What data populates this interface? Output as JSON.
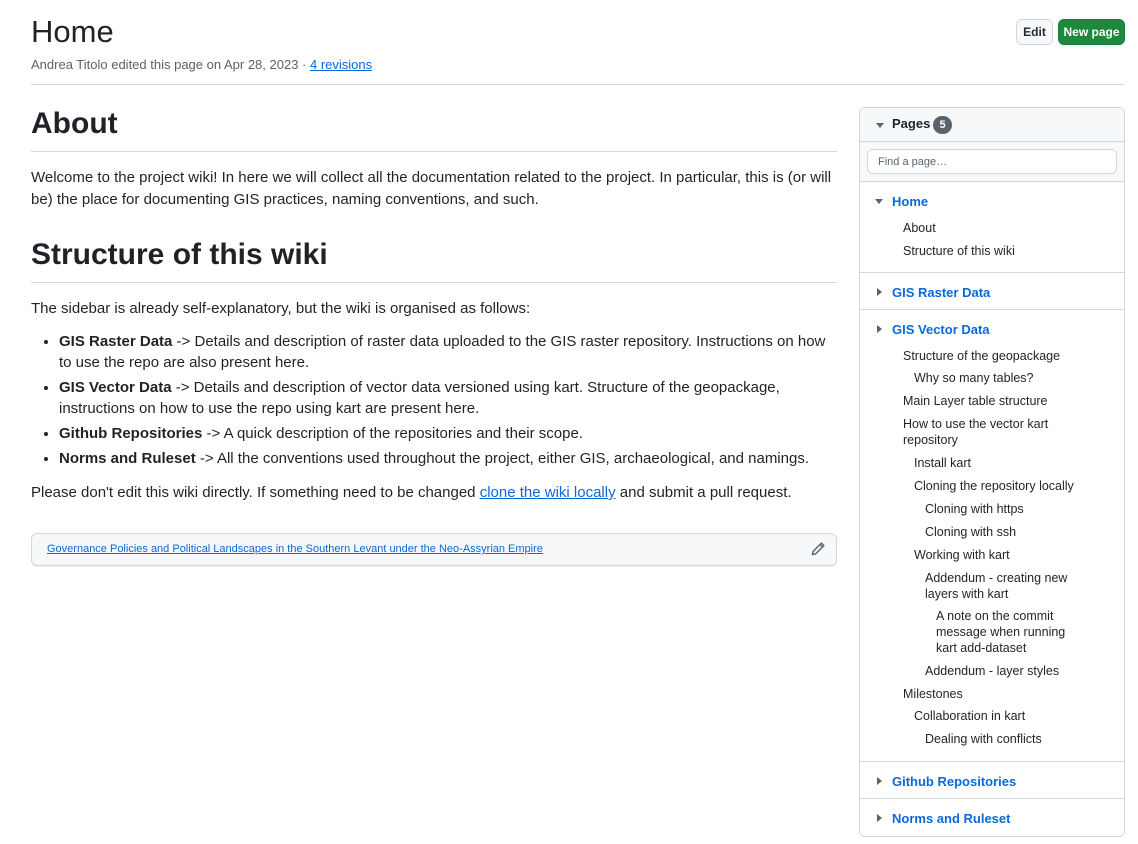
{
  "header": {
    "title": "Home",
    "meta_text": "Andrea Titolo edited this page on Apr 28, 2023 · ",
    "revisions_link": "4 revisions",
    "edit_label": "Edit",
    "new_page_label": "New page"
  },
  "content": {
    "about_heading": "About",
    "about_text": "Welcome to the project wiki! In here we will collect all the documentation related to the project. In particular, this is (or will be) the place for documenting GIS practices, naming conventions, and such.",
    "structure_heading": "Structure of this wiki",
    "structure_intro": "The sidebar is already self-explanatory, but the wiki is organised as follows:",
    "list": [
      {
        "bold": "GIS Raster Data",
        "text": " -> Details and description of raster data uploaded to the GIS raster repository. Instructions on how to use the repo are also present here."
      },
      {
        "bold": "GIS Vector Data",
        "text": " -> Details and description of vector data versioned using kart. Structure of the geopackage, instructions on how to use the repo using kart are present here."
      },
      {
        "bold": "Github Repositories",
        "text": " -> A quick description of the repositories and their scope."
      },
      {
        "bold": "Norms and Ruleset",
        "text": " -> All the conventions used throughout the project, either GIS, archaeological, and namings."
      }
    ],
    "closing_before": "Please don't edit this wiki directly. If something need to be changed ",
    "closing_link": "clone the wiki locally",
    "closing_after": " and submit a pull request.",
    "footer_link": "Governance Policies and Political Landscapes in the Southern Levant under the Neo-Assyrian Empire"
  },
  "sidebar": {
    "title": "Pages",
    "count": "5",
    "filter_placeholder": "Find a page…",
    "home": {
      "title": "Home",
      "items": [
        "About",
        "Structure of this wiki"
      ]
    },
    "raster": {
      "title": "GIS Raster Data"
    },
    "vector": {
      "title": "GIS Vector Data",
      "items": [
        "Structure of the geopackage",
        "Why so many tables?",
        "Main Layer table structure",
        "How to use the vector kart repository",
        "Install kart",
        "Cloning the repository locally",
        "Cloning with https",
        "Cloning with ssh",
        "Working with kart",
        "Addendum - creating new layers with kart",
        "A note on the commit message when running kart add-dataset",
        "Addendum - layer styles",
        "Milestones",
        "Collaboration in kart",
        "Dealing with conflicts"
      ]
    },
    "github": {
      "title": "Github Repositories"
    },
    "norms": {
      "title": "Norms and Ruleset"
    }
  }
}
